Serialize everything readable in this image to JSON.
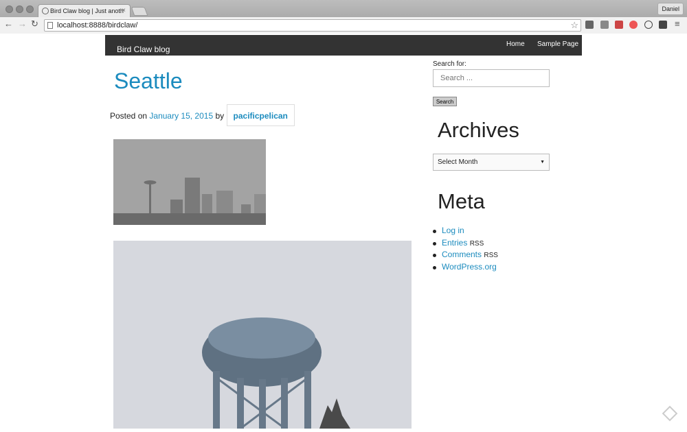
{
  "browser": {
    "tab_title": "Bird Claw blog | Just anoth",
    "tab_close": "×",
    "user": "Daniel",
    "url": "localhost:8888/birdclaw/",
    "back": "←",
    "forward": "→",
    "reload": "↻",
    "star": "☆",
    "menu": "≡"
  },
  "site": {
    "title": "Bird Claw blog",
    "menu": [
      "Home",
      "Sample Page"
    ]
  },
  "post": {
    "title": "Seattle",
    "posted_on": "Posted on",
    "date": "January 15, 2015",
    "by": "by",
    "author": "pacificpelican"
  },
  "sidebar": {
    "search_label": "Search for:",
    "search_placeholder": "Search ...",
    "search_button": "Search",
    "archives_title": "Archives",
    "archives_select": "Select Month",
    "meta_title": "Meta",
    "meta_links": [
      {
        "label": "Log in",
        "suffix": ""
      },
      {
        "label": "Entries",
        "suffix": "RSS"
      },
      {
        "label": "Comments",
        "suffix": "RSS"
      },
      {
        "label": "WordPress.org",
        "suffix": ""
      }
    ]
  },
  "colors": {
    "link": "#1b8bbe",
    "header_bg": "#333333"
  }
}
